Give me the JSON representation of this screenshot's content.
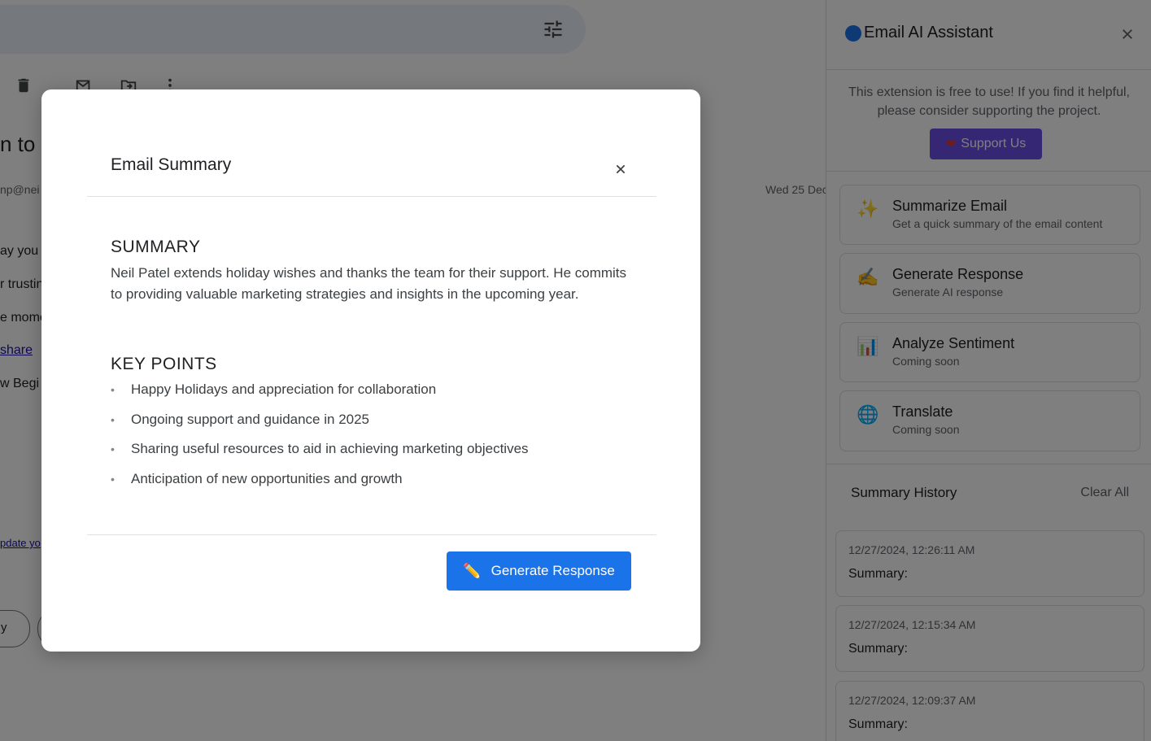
{
  "background": {
    "subject_fragment": "n to",
    "sender_fragment": "np@nei",
    "date_fragment": "Wed 25 Dec",
    "body_fragments": [
      "ay you",
      "r trustin",
      "e mome",
      " share",
      "w Begi"
    ],
    "footer_link_fragment": "pdate yo",
    "reply_pill_fragment": "y"
  },
  "modal": {
    "title": "Email Summary",
    "summary_heading": "SUMMARY",
    "summary_text": "Neil Patel extends holiday wishes and thanks the team for their support. He commits to providing valuable marketing strategies and insights in the upcoming year.",
    "key_points_heading": "KEY POINTS",
    "key_points": [
      "Happy Holidays and appreciation for collaboration",
      "Ongoing support and guidance in 2025",
      "Sharing useful resources to aid in achieving marketing objectives",
      "Anticipation of new opportunities and growth"
    ],
    "bullet": "•",
    "generate_button": "Generate Response"
  },
  "sidebar": {
    "title": "Email AI Assistant",
    "support_text": "This extension is free to use! If you find it helpful, please consider supporting the project.",
    "support_button": "Support Us",
    "features": [
      {
        "title": "Summarize Email",
        "subtitle": "Get a quick summary of the email content",
        "icon": "sparkles-icon",
        "glyph": "✨"
      },
      {
        "title": "Generate Response",
        "subtitle": "Generate AI response",
        "icon": "writing-hand-icon",
        "glyph": "✍"
      },
      {
        "title": "Analyze Sentiment",
        "subtitle": "Coming soon",
        "icon": "bar-chart-icon",
        "glyph": "📊"
      },
      {
        "title": "Translate",
        "subtitle": "Coming soon",
        "icon": "globe-icon",
        "glyph": "🌐"
      }
    ],
    "history_title": "Summary History",
    "clear_all": "Clear All",
    "history": [
      {
        "time": "12/27/2024, 12:26:11 AM",
        "label": "Summary:"
      },
      {
        "time": "12/27/2024, 12:15:34 AM",
        "label": "Summary:"
      },
      {
        "time": "12/27/2024, 12:09:37 AM",
        "label": "Summary:"
      }
    ]
  },
  "colors": {
    "accent": "#1a73e8",
    "support_button": "#6a4ee6",
    "scrim": "rgba(0,0,0,0.5)"
  }
}
